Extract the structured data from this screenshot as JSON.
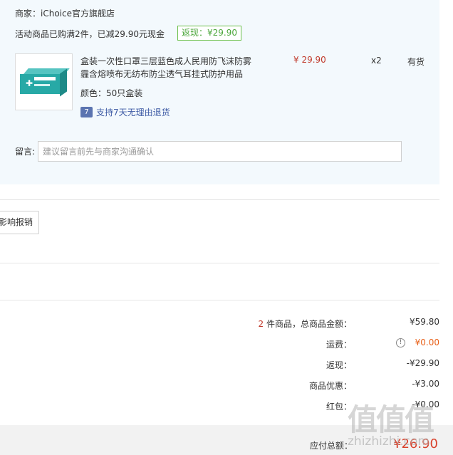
{
  "shop": {
    "label": "商家：iChoice官方旗舰店"
  },
  "promotion": {
    "text": "活动商品已购满2件，已减29.90元现金",
    "rebate_badge": "返现：¥29.90"
  },
  "item": {
    "title_line1": "盒装一次性口罩三层蓝色成人民用防飞沫防雾",
    "title_line2": "霾含熔喷布无纺布防尘透气耳挂式防护用品",
    "price": "¥ 29.90",
    "quantity": "x2",
    "stock": "有货",
    "variant": "颜色：50只盒装",
    "return_icon": "7",
    "return_policy": "支持7天无理由退货"
  },
  "message": {
    "label": "留言:",
    "placeholder": "建议留言前先与商家沟通确认"
  },
  "invoice_button": "影响报销",
  "summary": {
    "items_count": "2",
    "items_label": " 件商品，总商品金额：",
    "items_total": "¥59.80",
    "shipping_label": "运费：",
    "shipping_value": "¥0.00",
    "rebate_label": "返现：",
    "rebate_value": "-¥29.90",
    "discount_label": "商品优惠：",
    "discount_value": "-¥3.00",
    "redpacket_label": "红包：",
    "redpacket_value": "-¥0.00"
  },
  "total": {
    "label": "应付总额：",
    "value": "¥26.90"
  },
  "watermark": {
    "text": "值值值",
    "domain": "zhizhizhi.com"
  },
  "colors": {
    "panel_bg": "#f3f9fd",
    "price_red": "#c0392b",
    "shipping_orange": "#e8611a",
    "rebate_green": "#4aa63a",
    "link_blue": "#3e5ba5"
  }
}
